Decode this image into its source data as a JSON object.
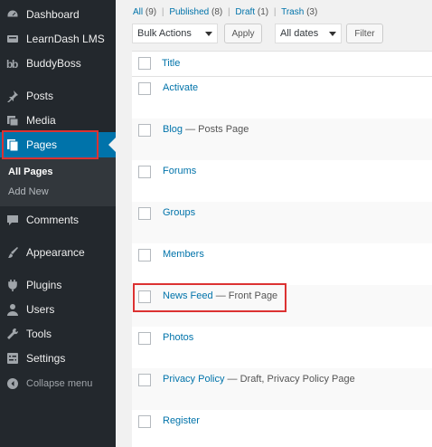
{
  "sidebar": {
    "items": [
      {
        "label": "Dashboard",
        "icon": "dashboard-icon"
      },
      {
        "label": "LearnDash LMS",
        "icon": "learndash-icon"
      },
      {
        "label": "BuddyBoss",
        "icon": "buddyboss-icon"
      },
      {
        "label": "Posts",
        "icon": "pin-icon"
      },
      {
        "label": "Media",
        "icon": "media-icon"
      },
      {
        "label": "Pages",
        "icon": "pages-icon"
      },
      {
        "label": "Comments",
        "icon": "comment-icon"
      },
      {
        "label": "Appearance",
        "icon": "brush-icon"
      },
      {
        "label": "Plugins",
        "icon": "plugin-icon"
      },
      {
        "label": "Users",
        "icon": "user-icon"
      },
      {
        "label": "Tools",
        "icon": "wrench-icon"
      },
      {
        "label": "Settings",
        "icon": "settings-icon"
      }
    ],
    "submenu": {
      "all_pages": "All Pages",
      "add_new": "Add New"
    },
    "collapse": "Collapse menu"
  },
  "filters": {
    "all": "All",
    "all_count": "(9)",
    "published": "Published",
    "published_count": "(8)",
    "draft": "Draft",
    "draft_count": "(1)",
    "trash": "Trash",
    "trash_count": "(3)",
    "sep": "|"
  },
  "toolbar": {
    "bulk_actions": "Bulk Actions",
    "apply": "Apply",
    "dates": "All dates",
    "filter": "Filter"
  },
  "table": {
    "column_title": "Title",
    "rows": [
      {
        "title": "Activate",
        "state": ""
      },
      {
        "title": "Blog",
        "state": " — Posts Page"
      },
      {
        "title": "Forums",
        "state": ""
      },
      {
        "title": "Groups",
        "state": ""
      },
      {
        "title": "Members",
        "state": ""
      },
      {
        "title": "News Feed",
        "state": " — Front Page"
      },
      {
        "title": "Photos",
        "state": ""
      },
      {
        "title": "Privacy Policy",
        "state": " — Draft, Privacy Policy Page"
      },
      {
        "title": "Register",
        "state": ""
      }
    ]
  },
  "colors": {
    "sidebar": "#23282d",
    "active": "#0073aa",
    "highlight": "#dc3232",
    "link": "#0073aa"
  }
}
